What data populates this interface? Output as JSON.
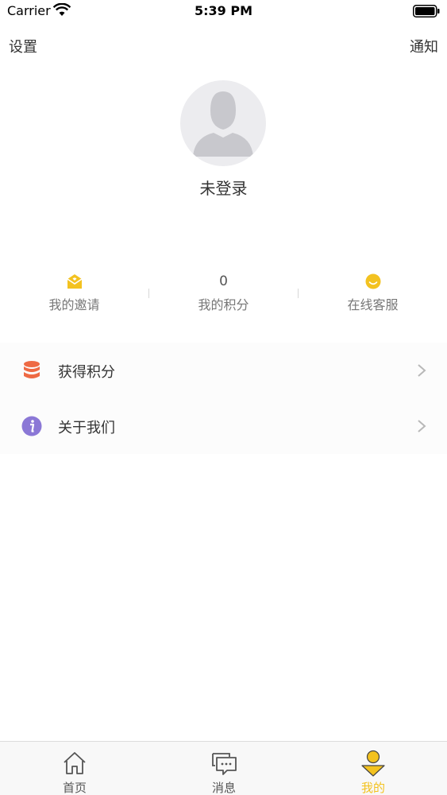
{
  "status_bar": {
    "carrier": "Carrier",
    "time": "5:39 PM"
  },
  "nav": {
    "settings": "设置",
    "notifications": "通知"
  },
  "profile": {
    "username": "未登录"
  },
  "stats": [
    {
      "label": "我的邀请",
      "icon": "envelope-icon"
    },
    {
      "label": "我的积分",
      "value": "0"
    },
    {
      "label": "在线客服",
      "icon": "smiley-icon"
    }
  ],
  "menu": [
    {
      "label": "获得积分",
      "icon": "database-icon"
    },
    {
      "label": "关于我们",
      "icon": "info-icon"
    }
  ],
  "tabs": [
    {
      "label": "首页",
      "icon": "home-icon"
    },
    {
      "label": "消息",
      "icon": "message-icon"
    },
    {
      "label": "我的",
      "icon": "profile-icon"
    }
  ],
  "colors": {
    "accent": "#f3c220",
    "database": "#ee6a44",
    "info": "#8b78d6"
  }
}
